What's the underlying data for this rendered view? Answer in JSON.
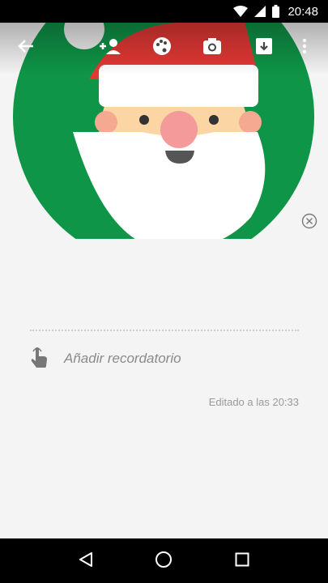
{
  "status_bar": {
    "time": "20:48",
    "icons": [
      "wifi-icon",
      "cell-signal-icon",
      "battery-icon"
    ]
  },
  "toolbar": {
    "actions": [
      "back-arrow-icon",
      "add-person-icon",
      "palette-icon",
      "camera-icon",
      "archive-icon",
      "more-vert-icon"
    ]
  },
  "note": {
    "image": "santa-claus-illustration",
    "reminder_label": "Añadir recordatorio",
    "edited_text": "Editado a las 20:33"
  },
  "navigation": {
    "buttons": [
      "back-triangle-icon",
      "home-circle-icon",
      "recents-square-icon"
    ]
  },
  "colors": {
    "santa_green": "#0f9547",
    "santa_red": "#e53935",
    "skin": "#fcd5a4",
    "nose": "#f49a9a",
    "background": "#f4f4f4",
    "system_bars": "#000000"
  }
}
